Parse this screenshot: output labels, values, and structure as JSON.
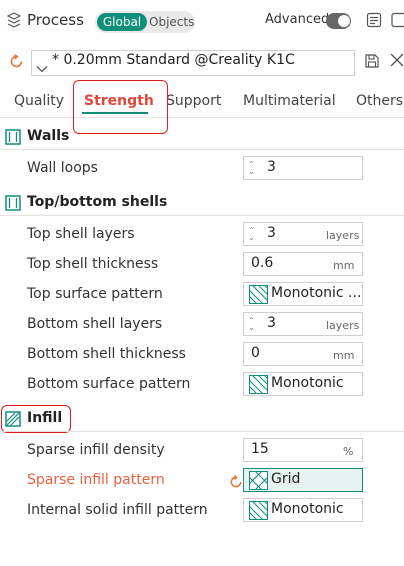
{
  "header": {
    "title": "Process",
    "mode_global": "Global",
    "mode_objects": "Objects",
    "advanced_label": "Advanced"
  },
  "preset": {
    "name": "* 0.20mm Standard @Creality K1C"
  },
  "tabs": [
    "Quality",
    "Strength",
    "Support",
    "Multimaterial",
    "Others"
  ],
  "sections": {
    "walls": {
      "title": "Walls",
      "wall_loops": {
        "label": "Wall loops",
        "value": "3"
      }
    },
    "top_bottom": {
      "title": "Top/bottom shells",
      "top_layers": {
        "label": "Top shell layers",
        "value": "3",
        "unit": "layers"
      },
      "top_thickness": {
        "label": "Top shell thickness",
        "value": "0.6",
        "unit": "mm"
      },
      "top_pattern": {
        "label": "Top surface pattern",
        "value": "Monotonic ..."
      },
      "bottom_layers": {
        "label": "Bottom shell layers",
        "value": "3",
        "unit": "layers"
      },
      "bottom_thickness": {
        "label": "Bottom shell thickness",
        "value": "0",
        "unit": "mm"
      },
      "bottom_pattern": {
        "label": "Bottom surface pattern",
        "value": "Monotonic"
      }
    },
    "infill": {
      "title": "Infill",
      "density": {
        "label": "Sparse infill density",
        "value": "15",
        "unit": "%"
      },
      "pattern": {
        "label": "Sparse infill pattern",
        "value": "Grid"
      },
      "internal_pattern": {
        "label": "Internal solid infill pattern",
        "value": "Monotonic"
      }
    }
  },
  "colors": {
    "accent": "#0e8f7a",
    "modified": "#e8623e",
    "annotation": "#e0201a"
  }
}
